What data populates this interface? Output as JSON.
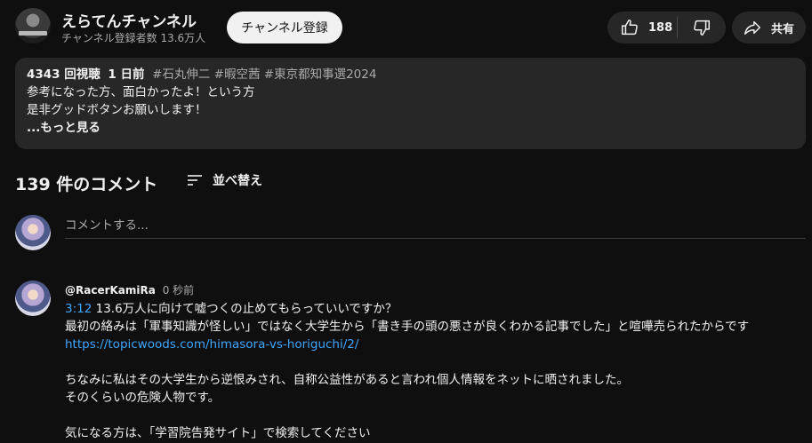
{
  "channel": {
    "name": "えらてんチャンネル",
    "subscribers": "チャンネル登録者数 13.6万人",
    "subscribe_label": "チャンネル登録"
  },
  "actions": {
    "like_count": "188",
    "share_label": "共有"
  },
  "description": {
    "views": "4343 回視聴",
    "age": "1 日前",
    "tags": "#石丸伸二 #暇空茜 #東京都知事選2024",
    "line1": "参考になった方、面白かったよ！という方",
    "line2": "是非グッドボタンお願いします！",
    "more_label": "...もっと見る"
  },
  "comments": {
    "count_label": "139 件のコメント",
    "sort_label": "並べ替え",
    "add_placeholder": "コメントする...",
    "items": [
      {
        "author": "@RacerKamiRa",
        "time": "0 秒前",
        "timestamp_link": "3:12",
        "line1": " 13.6万人に向けて嘘つくの止めてもらっていいですか？",
        "line2": "最初の絡みは「軍事知識が怪しい」ではなく大学生から「書き手の頭の悪さが良くわかる記事でした」と喧嘩売られたからです",
        "url": "https://topicwoods.com/himasora-vs-horiguchi/2/",
        "line3": "ちなみに私はその大学生から逆恨みされ、自称公益性があると言われ個人情報をネットに晒されました。",
        "line4": "そのくらいの危険人物です。",
        "line5": "気になる方は、「学習院告発サイト」で検索してください"
      }
    ]
  }
}
